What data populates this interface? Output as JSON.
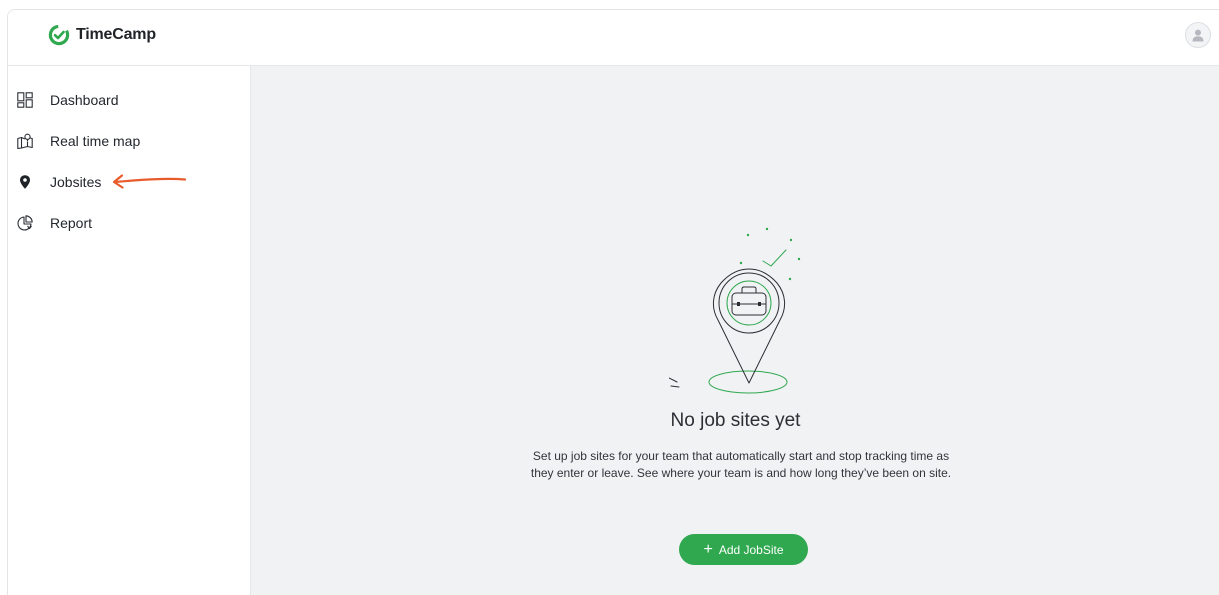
{
  "app": {
    "name": "TimeCamp",
    "brand_color": "#2fa84f"
  },
  "sidebar": {
    "items": [
      {
        "label": "Dashboard",
        "icon": "dashboard-grid-icon"
      },
      {
        "label": "Real time map",
        "icon": "map-icon"
      },
      {
        "label": "Jobsites",
        "icon": "location-pin-icon",
        "active": true
      },
      {
        "label": "Report",
        "icon": "pie-chart-icon"
      }
    ]
  },
  "empty_state": {
    "title": "No job sites yet",
    "description": "Set up job sites for your team that automatically start and stop tracking time as they enter or leave. See where your team is and how long they’ve been on site.",
    "button_label": "Add JobSite",
    "button_icon": "plus-icon",
    "illustration": "location-pin-briefcase-illustration"
  },
  "annotation": {
    "arrow_color": "#e85c2c",
    "arrow_icon": "arrow-left-annotation"
  }
}
